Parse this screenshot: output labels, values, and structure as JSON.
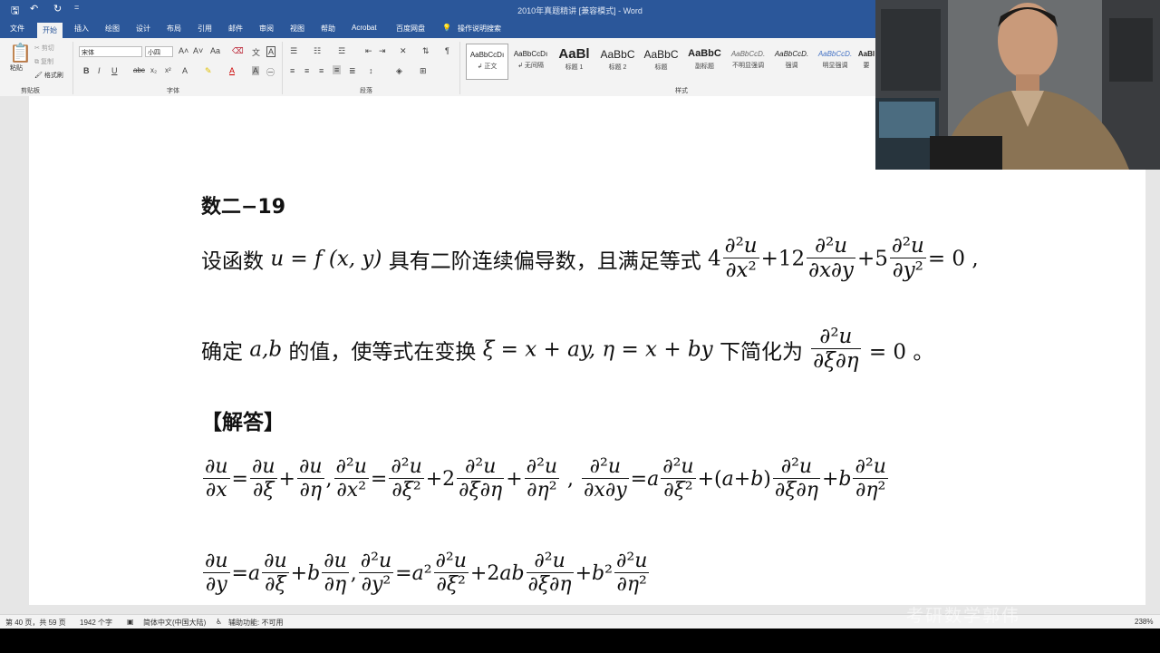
{
  "window": {
    "title": "2010年真题精讲 [兼容模式] - Word"
  },
  "quick_access": {
    "save": "🖫",
    "undo": "↶",
    "redo": "↻",
    "customize": "="
  },
  "tabs": [
    {
      "label": "文件"
    },
    {
      "label": "开始"
    },
    {
      "label": "插入"
    },
    {
      "label": "绘图"
    },
    {
      "label": "设计"
    },
    {
      "label": "布局"
    },
    {
      "label": "引用"
    },
    {
      "label": "邮件"
    },
    {
      "label": "审阅"
    },
    {
      "label": "视图"
    },
    {
      "label": "帮助"
    },
    {
      "label": "Acrobat"
    },
    {
      "label": "百度网盘"
    },
    {
      "label": "操作说明搜索"
    }
  ],
  "ribbon": {
    "clipboard": {
      "paste": "粘贴",
      "cut": "剪切",
      "copy": "复制",
      "format_painter": "格式刷",
      "group": "剪贴板"
    },
    "font": {
      "font_name": "宋体",
      "font_size": "小四",
      "group": "字体"
    },
    "paragraph": {
      "group": "段落"
    },
    "styles": {
      "group": "样式",
      "items": [
        {
          "preview": "AaBbCcDı",
          "name": "↲ 正文"
        },
        {
          "preview": "AaBbCcDı",
          "name": "↲ 无间隔"
        },
        {
          "preview": "AaBl",
          "name": "标题 1"
        },
        {
          "preview": "AaBbC",
          "name": "标题 2"
        },
        {
          "preview": "AaBbC",
          "name": "标题"
        },
        {
          "preview": "AaBbC",
          "name": "副标题"
        },
        {
          "preview": "AaBbCcD.",
          "name": "不明显强调"
        },
        {
          "preview": "AaBbCcD.",
          "name": "强调"
        },
        {
          "preview": "AaBbCcD.",
          "name": "明显强调"
        },
        {
          "preview": "AaBl",
          "name": "要"
        }
      ]
    }
  },
  "document": {
    "heading": "数二−19",
    "q1_prefix": "设函数",
    "q1_func": "u = f (x, y)",
    "q1_mid": "具有二阶连续偏导数，且满足等式",
    "q2_prefix": "确定",
    "q2_ab": "a,b",
    "q2_mid": "的值，使等式在变换",
    "q2_transform": "ξ = x + ay, η = x + by",
    "q2_mid2": "下简化为",
    "q2_end": "= 0 。",
    "answer_label": "【解答】"
  },
  "status_bar": {
    "page": "第 40 页，共 59 页",
    "words": "1942 个字",
    "language": "简体中文(中国大陆)",
    "accessibility": "辅助功能: 不可用",
    "zoom": "238%"
  },
  "webcam": {
    "watermark": "考研数学郭伟"
  }
}
